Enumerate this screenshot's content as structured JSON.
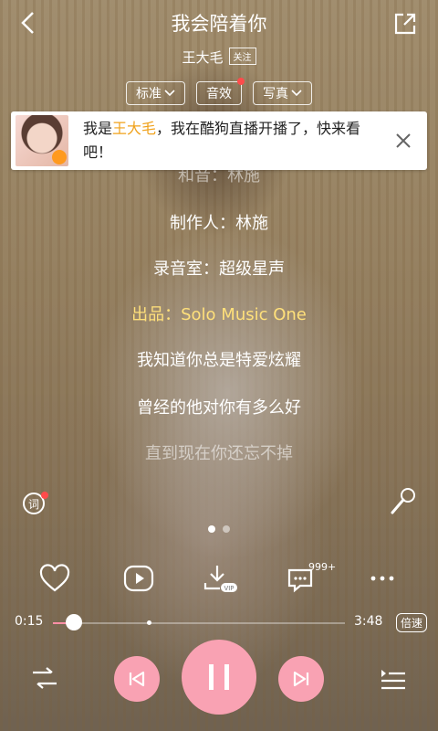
{
  "header": {
    "title": "我会陪着你",
    "artist": "王大毛",
    "follow_label": "关注"
  },
  "pills": [
    {
      "label": "标准"
    },
    {
      "label": "音效"
    },
    {
      "label": "写真"
    }
  ],
  "banner": {
    "prefix": "我是",
    "highlight": "王大毛",
    "suffix": "，我在酷狗直播开播了，快来看吧！"
  },
  "lyrics": [
    {
      "text": "和音：林施"
    },
    {
      "text": "制作人：林施"
    },
    {
      "text": "录音室：超级星声"
    },
    {
      "text": "出品：Solo Music One"
    },
    {
      "text": "我知道你总是特爱炫耀"
    },
    {
      "text": "曾经的他对你有多么好"
    },
    {
      "text": "直到现在你还忘不掉"
    }
  ],
  "actions": {
    "comment_count": "999+"
  },
  "progress": {
    "elapsed": "0:15",
    "total": "3:48",
    "played_fraction": 0.072,
    "buffered_fraction": 0.33,
    "speed_label": "倍速"
  },
  "colors": {
    "accent": "#f9a2b3",
    "current_lyric": "#ffe07a",
    "highlight": "#f0a21c"
  }
}
